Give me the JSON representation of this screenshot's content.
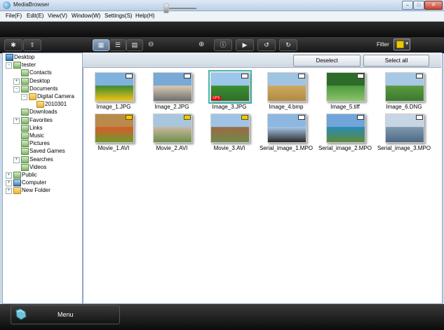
{
  "window": {
    "title": "MediaBrowser",
    "controls": [
      "–",
      "□",
      "✕"
    ]
  },
  "menu": [
    "File(F)",
    "Edit(E)",
    "View(V)",
    "Window(W)",
    "Settings(S)",
    "Help(H)"
  ],
  "toolbar": {
    "filter_label": "Filter"
  },
  "content_bar": {
    "deselect": "Deselect",
    "select_all": "Select all"
  },
  "tree": [
    {
      "label": "Desktop",
      "icon": "desktop-icon",
      "expander": ""
    },
    {
      "label": "tester",
      "icon": "user-folder-icon",
      "expander": "−"
    },
    {
      "label": "Contacts",
      "icon": "contacts-folder-icon",
      "expander": ""
    },
    {
      "label": "Desktop",
      "icon": "desktop-folder-icon",
      "expander": "+"
    },
    {
      "label": "Documents",
      "icon": "documents-folder-icon",
      "expander": "−"
    },
    {
      "label": "Digital Camera",
      "icon": "folder-icon",
      "expander": "−"
    },
    {
      "label": "2010301",
      "icon": "folder-icon",
      "expander": ""
    },
    {
      "label": "Downloads",
      "icon": "downloads-folder-icon",
      "expander": ""
    },
    {
      "label": "Favorites",
      "icon": "favorites-folder-icon",
      "expander": "+"
    },
    {
      "label": "Links",
      "icon": "links-folder-icon",
      "expander": ""
    },
    {
      "label": "Music",
      "icon": "music-folder-icon",
      "expander": ""
    },
    {
      "label": "Pictures",
      "icon": "pictures-folder-icon",
      "expander": ""
    },
    {
      "label": "Saved Games",
      "icon": "saved-games-folder-icon",
      "expander": ""
    },
    {
      "label": "Searches",
      "icon": "searches-folder-icon",
      "expander": "+"
    },
    {
      "label": "Videos",
      "icon": "videos-folder-icon",
      "expander": ""
    },
    {
      "label": "Public",
      "icon": "public-folder-icon",
      "expander": "+"
    },
    {
      "label": "Computer",
      "icon": "computer-icon",
      "expander": "+"
    },
    {
      "label": "New Folder",
      "icon": "folder-icon",
      "expander": "+"
    }
  ],
  "files": [
    {
      "name": "Image_1.JPG",
      "badge": "white",
      "colors": [
        "#7fb2df",
        "#3f8a2e",
        "#f0c419"
      ]
    },
    {
      "name": "Image_2.JPG",
      "badge": "white",
      "colors": [
        "#79a9d6",
        "#d9cbb3",
        "#6e6e6e"
      ]
    },
    {
      "name": "Image_3.JPG",
      "badge": "white",
      "colors": [
        "#9cc7ea",
        "#3b8f34",
        "#2f6d2a"
      ],
      "gps": "GPS",
      "selected": true
    },
    {
      "name": "Image_4.bmp",
      "badge": "white",
      "colors": [
        "#9fc4e2",
        "#cfa95f",
        "#b08a43"
      ]
    },
    {
      "name": "Image_5.tiff",
      "badge": "white",
      "colors": [
        "#2d6b2a",
        "#4e9a3d",
        "#8cc26a"
      ]
    },
    {
      "name": "Image_6.DNG",
      "badge": "white",
      "colors": [
        "#a7c9e6",
        "#5b9a3f",
        "#3a7a2e"
      ]
    },
    {
      "name": "Movie_1.AVI",
      "badge": "gold",
      "colors": [
        "#b98a4a",
        "#d65c2a",
        "#6f9a2e"
      ]
    },
    {
      "name": "Movie_2.AVI",
      "badge": "gold",
      "colors": [
        "#a9c6df",
        "#c9b8a0",
        "#6c8f4a"
      ]
    },
    {
      "name": "Movie_3.AVI",
      "badge": "gold",
      "colors": [
        "#9ec3e4",
        "#9c6a44",
        "#6f8a4a"
      ]
    },
    {
      "name": "Serial_image_1.MPO",
      "badge": "white",
      "colors": [
        "#8db7e0",
        "#a4c6e8",
        "#2a2a2a"
      ]
    },
    {
      "name": "Serial_image_2.MPO",
      "badge": "white",
      "colors": [
        "#6fa5d8",
        "#2a8ab5",
        "#5f8a3a"
      ]
    },
    {
      "name": "Serial_image_3.MPO",
      "badge": "white",
      "colors": [
        "#c7d6e4",
        "#7f98ad",
        "#4d6a84"
      ]
    }
  ],
  "bottom": {
    "menu_label": "Menu"
  }
}
